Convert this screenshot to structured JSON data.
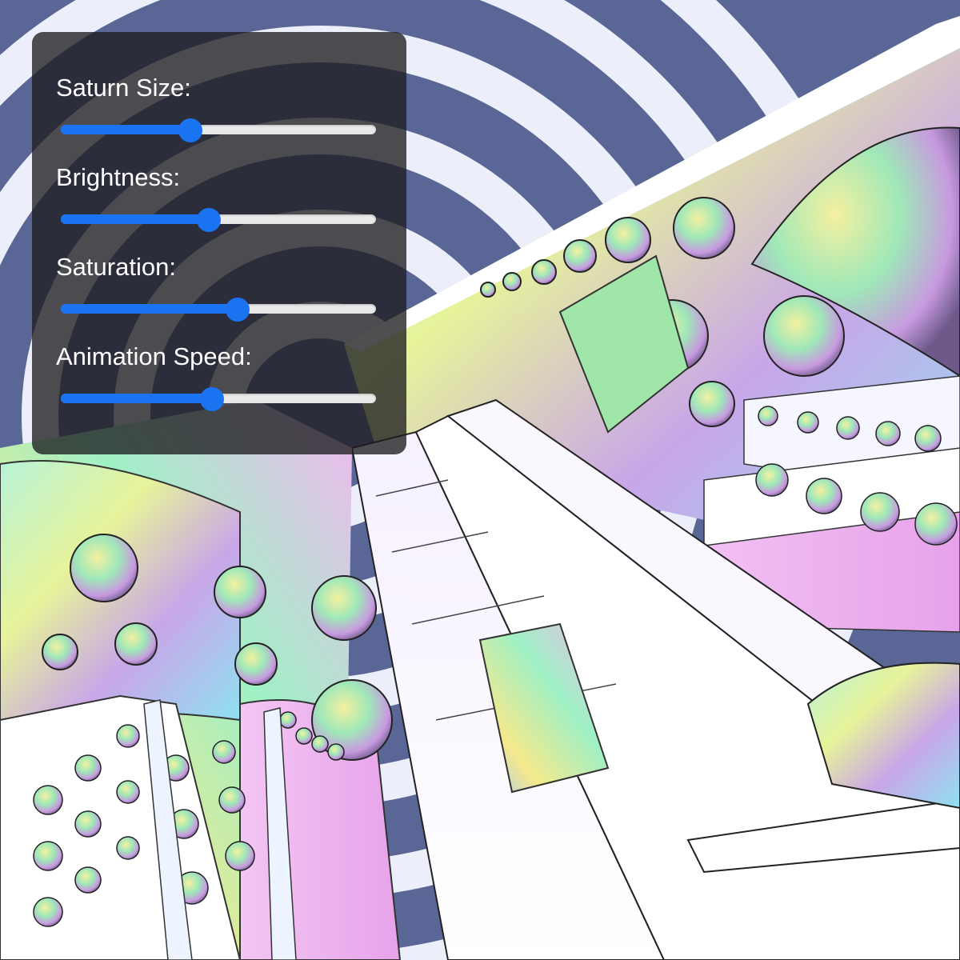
{
  "scene": {
    "name": "fractal-render",
    "sky_color": "#5a6796",
    "ring_color": "#f4f6ff"
  },
  "controls": [
    {
      "id": "saturn-size",
      "label": "Saturn Size:",
      "value": 0.41
    },
    {
      "id": "brightness",
      "label": "Brightness:",
      "value": 0.47
    },
    {
      "id": "saturation",
      "label": "Saturation:",
      "value": 0.56
    },
    {
      "id": "animation-speed",
      "label": "Animation Speed:",
      "value": 0.48
    }
  ],
  "colors": {
    "panel_bg": "rgba(30,30,32,0.78)",
    "slider_accent": "#1a73f0",
    "slider_track": "#e9e9e9",
    "label_text": "#ffffff"
  }
}
